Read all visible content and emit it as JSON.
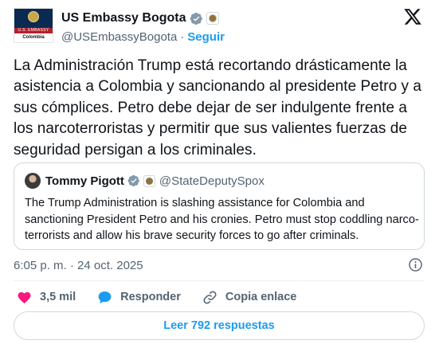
{
  "account": {
    "display_name": "US Embassy Bogota",
    "handle": "@USEmbassyBogota",
    "separator": "·",
    "follow_label": "Seguir",
    "avatar_lines": {
      "band_text": "U.S. EMBASSY",
      "country_text": "Colombia"
    }
  },
  "tweet": {
    "text": "La Administración Trump está recortando drásticamente la asistencia a Colombia y sancionando al presidente Petro y a sus cómplices. Petro debe dejar de ser indulgente frente a los narcoterroristas y permitir que sus valientes fuerzas de seguridad persigan a los criminales.",
    "timestamp": "6:05 p. m. · 24 oct. 2025"
  },
  "quote": {
    "display_name": "Tommy Pigott",
    "handle": "@StateDeputySpox",
    "text": "The Trump Administration is slashing assistance for Colombia and sanctioning President Petro and his cronies. Petro must stop coddling narco-terrorists and allow his brave security forces to go after criminals."
  },
  "actions": {
    "like_count": "3,5 mil",
    "reply_label": "Responder",
    "copy_label": "Copia enlace"
  },
  "replies_button": "Leer 792 respuestas",
  "colors": {
    "accent": "#1d9bf0",
    "text": "#0f1419",
    "muted": "#536471",
    "like": "#f91880",
    "verified_badge": "#829aab",
    "border": "#cfd9de"
  },
  "icons": [
    "verified-badge-icon",
    "government-affiliation-icon",
    "x-logo-icon",
    "info-icon",
    "heart-icon",
    "speech-bubble-icon",
    "link-icon"
  ]
}
